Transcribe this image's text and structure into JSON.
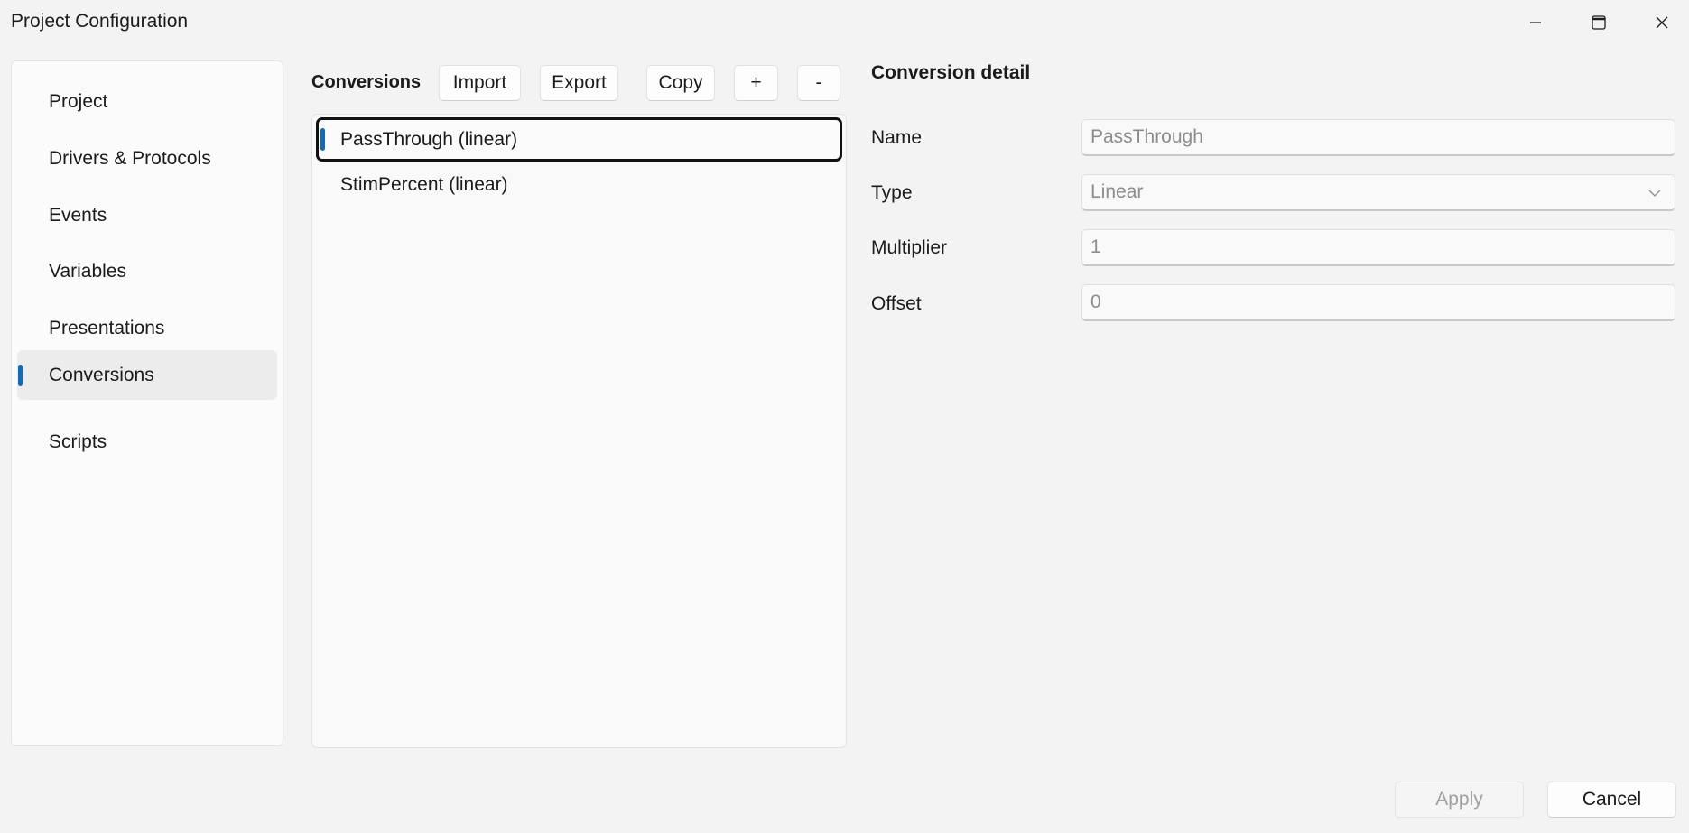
{
  "window": {
    "title": "Project Configuration",
    "controls": {
      "minimize": "minimize-icon",
      "maximize": "maximize-icon",
      "close": "close-icon"
    }
  },
  "sidebar": {
    "items": [
      {
        "label": "Project",
        "selected": false
      },
      {
        "label": "Drivers & Protocols",
        "selected": false
      },
      {
        "label": "Events",
        "selected": false
      },
      {
        "label": "Variables",
        "selected": false
      },
      {
        "label": "Presentations",
        "selected": false
      },
      {
        "label": "Conversions",
        "selected": true
      },
      {
        "label": "Scripts",
        "selected": false
      }
    ]
  },
  "conversions": {
    "title": "Conversions",
    "toolbar": {
      "import": "Import",
      "export": "Export",
      "copy": "Copy",
      "add": "+",
      "remove": "-"
    },
    "items": [
      {
        "label": "PassThrough (linear)",
        "selected": true
      },
      {
        "label": "StimPercent (linear)",
        "selected": false
      }
    ]
  },
  "detail": {
    "title": "Conversion detail",
    "fields": {
      "name": {
        "label": "Name",
        "value": "PassThrough"
      },
      "type": {
        "label": "Type",
        "value": "Linear"
      },
      "multiplier": {
        "label": "Multiplier",
        "value": "1"
      },
      "offset": {
        "label": "Offset",
        "value": "0"
      }
    }
  },
  "footer": {
    "apply": "Apply",
    "cancel": "Cancel",
    "apply_enabled": false
  },
  "colors": {
    "accent": "#0f6cbd",
    "background": "#f3f3f3",
    "disabled_text": "#a0a0a0"
  }
}
